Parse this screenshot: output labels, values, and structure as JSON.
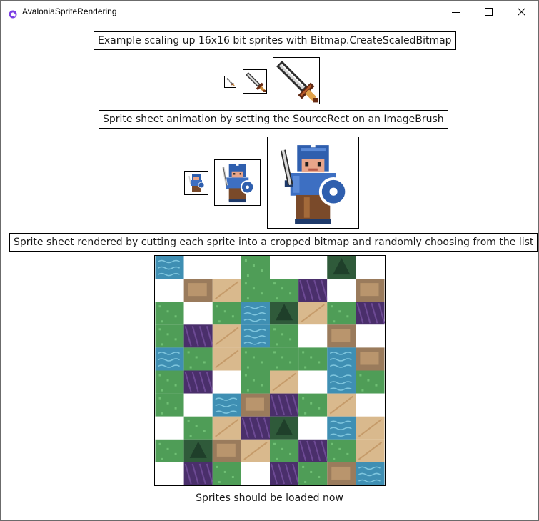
{
  "window": {
    "title": "AvaloniaSpriteRendering",
    "accent": "#7b3fe4"
  },
  "icons": {
    "minimize": "minimize-icon",
    "maximize": "maximize-icon",
    "close": "close-icon",
    "app": "avalonia-logo-icon"
  },
  "section_scaled": {
    "label": "Example scaling up 16x16 bit sprites with Bitmap.CreateScaledBitmap"
  },
  "section_animation": {
    "label": "Sprite sheet animation by setting the SourceRect on an ImageBrush"
  },
  "section_tiles": {
    "label": "Sprite sheet rendered by cutting each sprite into a cropped bitmap and randomly choosing from the list"
  },
  "status": {
    "text": "Sprites should be loaded now"
  },
  "tile_colors": {
    "grass": "#4f9d57",
    "water": "#3f8fb3",
    "sand": "#d9b98d",
    "rock": "#9a7b5c",
    "purple": "#4a2f6b",
    "tree": "#2f5a3a",
    "empty": "#ffffff"
  },
  "tile_grid": [
    "WE.GE.TE",
    "ERSGAP.R",
    "GEAWTSGP",
    "GPSWG.RE",
    "WGSAGGWR",
    "GPEGSEWG",
    "GEWRPGSE",
    "EGSPTEWS",
    "GTRSGPGS",
    "EPGEPGRW"
  ]
}
